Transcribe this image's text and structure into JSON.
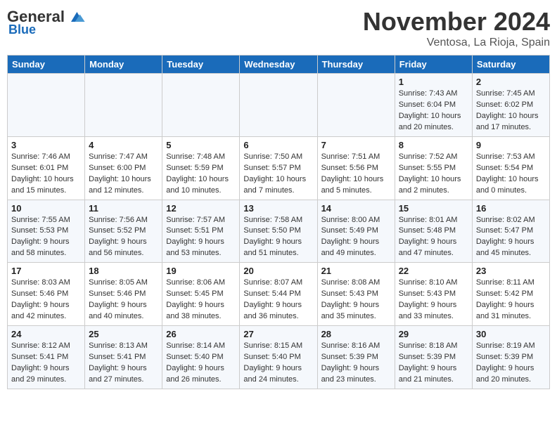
{
  "header": {
    "logo_general": "General",
    "logo_blue": "Blue",
    "month_year": "November 2024",
    "location": "Ventosa, La Rioja, Spain"
  },
  "calendar": {
    "days_of_week": [
      "Sunday",
      "Monday",
      "Tuesday",
      "Wednesday",
      "Thursday",
      "Friday",
      "Saturday"
    ],
    "weeks": [
      [
        {
          "day": "",
          "info": ""
        },
        {
          "day": "",
          "info": ""
        },
        {
          "day": "",
          "info": ""
        },
        {
          "day": "",
          "info": ""
        },
        {
          "day": "",
          "info": ""
        },
        {
          "day": "1",
          "info": "Sunrise: 7:43 AM\nSunset: 6:04 PM\nDaylight: 10 hours and 20 minutes."
        },
        {
          "day": "2",
          "info": "Sunrise: 7:45 AM\nSunset: 6:02 PM\nDaylight: 10 hours and 17 minutes."
        }
      ],
      [
        {
          "day": "3",
          "info": "Sunrise: 7:46 AM\nSunset: 6:01 PM\nDaylight: 10 hours and 15 minutes."
        },
        {
          "day": "4",
          "info": "Sunrise: 7:47 AM\nSunset: 6:00 PM\nDaylight: 10 hours and 12 minutes."
        },
        {
          "day": "5",
          "info": "Sunrise: 7:48 AM\nSunset: 5:59 PM\nDaylight: 10 hours and 10 minutes."
        },
        {
          "day": "6",
          "info": "Sunrise: 7:50 AM\nSunset: 5:57 PM\nDaylight: 10 hours and 7 minutes."
        },
        {
          "day": "7",
          "info": "Sunrise: 7:51 AM\nSunset: 5:56 PM\nDaylight: 10 hours and 5 minutes."
        },
        {
          "day": "8",
          "info": "Sunrise: 7:52 AM\nSunset: 5:55 PM\nDaylight: 10 hours and 2 minutes."
        },
        {
          "day": "9",
          "info": "Sunrise: 7:53 AM\nSunset: 5:54 PM\nDaylight: 10 hours and 0 minutes."
        }
      ],
      [
        {
          "day": "10",
          "info": "Sunrise: 7:55 AM\nSunset: 5:53 PM\nDaylight: 9 hours and 58 minutes."
        },
        {
          "day": "11",
          "info": "Sunrise: 7:56 AM\nSunset: 5:52 PM\nDaylight: 9 hours and 56 minutes."
        },
        {
          "day": "12",
          "info": "Sunrise: 7:57 AM\nSunset: 5:51 PM\nDaylight: 9 hours and 53 minutes."
        },
        {
          "day": "13",
          "info": "Sunrise: 7:58 AM\nSunset: 5:50 PM\nDaylight: 9 hours and 51 minutes."
        },
        {
          "day": "14",
          "info": "Sunrise: 8:00 AM\nSunset: 5:49 PM\nDaylight: 9 hours and 49 minutes."
        },
        {
          "day": "15",
          "info": "Sunrise: 8:01 AM\nSunset: 5:48 PM\nDaylight: 9 hours and 47 minutes."
        },
        {
          "day": "16",
          "info": "Sunrise: 8:02 AM\nSunset: 5:47 PM\nDaylight: 9 hours and 45 minutes."
        }
      ],
      [
        {
          "day": "17",
          "info": "Sunrise: 8:03 AM\nSunset: 5:46 PM\nDaylight: 9 hours and 42 minutes."
        },
        {
          "day": "18",
          "info": "Sunrise: 8:05 AM\nSunset: 5:46 PM\nDaylight: 9 hours and 40 minutes."
        },
        {
          "day": "19",
          "info": "Sunrise: 8:06 AM\nSunset: 5:45 PM\nDaylight: 9 hours and 38 minutes."
        },
        {
          "day": "20",
          "info": "Sunrise: 8:07 AM\nSunset: 5:44 PM\nDaylight: 9 hours and 36 minutes."
        },
        {
          "day": "21",
          "info": "Sunrise: 8:08 AM\nSunset: 5:43 PM\nDaylight: 9 hours and 35 minutes."
        },
        {
          "day": "22",
          "info": "Sunrise: 8:10 AM\nSunset: 5:43 PM\nDaylight: 9 hours and 33 minutes."
        },
        {
          "day": "23",
          "info": "Sunrise: 8:11 AM\nSunset: 5:42 PM\nDaylight: 9 hours and 31 minutes."
        }
      ],
      [
        {
          "day": "24",
          "info": "Sunrise: 8:12 AM\nSunset: 5:41 PM\nDaylight: 9 hours and 29 minutes."
        },
        {
          "day": "25",
          "info": "Sunrise: 8:13 AM\nSunset: 5:41 PM\nDaylight: 9 hours and 27 minutes."
        },
        {
          "day": "26",
          "info": "Sunrise: 8:14 AM\nSunset: 5:40 PM\nDaylight: 9 hours and 26 minutes."
        },
        {
          "day": "27",
          "info": "Sunrise: 8:15 AM\nSunset: 5:40 PM\nDaylight: 9 hours and 24 minutes."
        },
        {
          "day": "28",
          "info": "Sunrise: 8:16 AM\nSunset: 5:39 PM\nDaylight: 9 hours and 23 minutes."
        },
        {
          "day": "29",
          "info": "Sunrise: 8:18 AM\nSunset: 5:39 PM\nDaylight: 9 hours and 21 minutes."
        },
        {
          "day": "30",
          "info": "Sunrise: 8:19 AM\nSunset: 5:39 PM\nDaylight: 9 hours and 20 minutes."
        }
      ]
    ]
  }
}
